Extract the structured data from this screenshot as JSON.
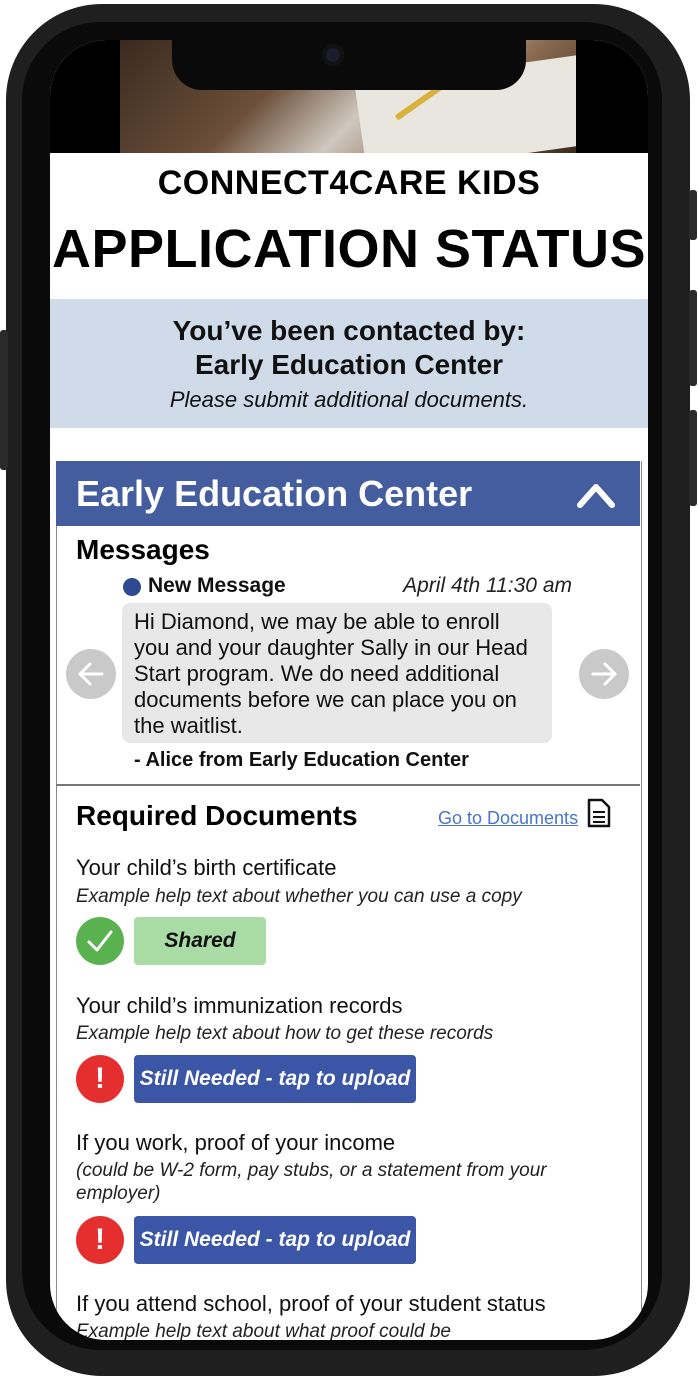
{
  "header": {
    "brand": "CONNECT4CARE KIDS",
    "title": "APPLICATION STATUS"
  },
  "alert": {
    "line1": "You’ve been contacted by:",
    "line2": "Early Education Center",
    "line3": "Please submit additional documents."
  },
  "center_card": {
    "title": "Early Education Center",
    "messages_heading": "Messages",
    "message": {
      "status": "New Message",
      "timestamp": "April 4th 11:30 am",
      "body": "Hi Diamond, we may be able to enroll you and your daughter Sally in our Head Start program. We do need additional documents before we can place you on the waitlist.",
      "signature": "- Alice from Early Education Center"
    }
  },
  "required_documents": {
    "title": "Required Documents",
    "go_to_link": "Go to Documents",
    "items": [
      {
        "title": "Your child’s birth certificate",
        "help": "Example help text about whether you can use a copy",
        "status": "Shared"
      },
      {
        "title": "Your child’s immunization records",
        "help": "Example help text about how to get these records",
        "status": "Still Needed - tap to upload"
      },
      {
        "title": "If you work, proof of your income",
        "help": "(could be W-2 form, pay stubs, or a statement from your employer)",
        "status": "Still Needed - tap to upload"
      },
      {
        "title": "If you attend school, proof of your student status",
        "help": "Example help text about what proof could be"
      }
    ]
  },
  "colors": {
    "header_blue": "#445d9e",
    "alert_bg": "#d0dbe9",
    "shared_green": "#a9dba5",
    "ok_green": "#59b24f",
    "error_red": "#e52e2e",
    "upload_blue": "#3b56a6",
    "link_blue": "#4a74c9"
  },
  "icons": {
    "collapse": "chevron-up-icon",
    "prev": "arrow-left-icon",
    "next": "arrow-right-icon",
    "documents": "document-icon",
    "shared": "check-icon",
    "needed": "exclamation-icon"
  }
}
